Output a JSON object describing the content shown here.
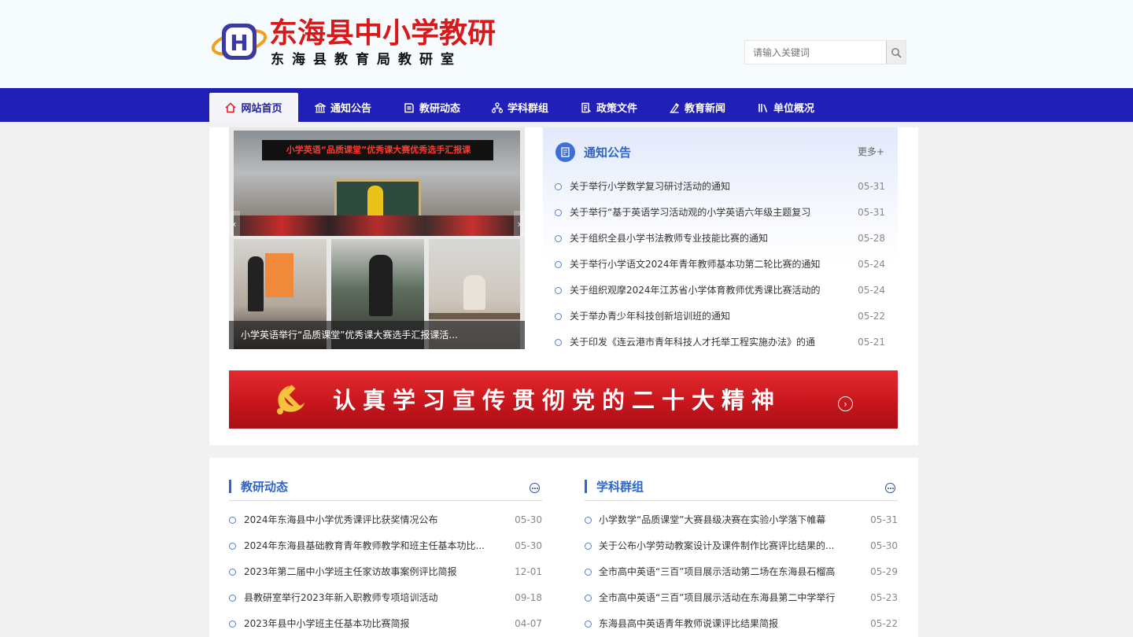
{
  "site": {
    "title": "东海县中小学教研",
    "subtitle": "东海县教育局教研室",
    "logo_letter": "H"
  },
  "search": {
    "placeholder": "请输入关键词",
    "button_icon": "search-icon"
  },
  "nav": {
    "items": [
      {
        "label": "网站首页",
        "icon": "home-icon",
        "active": true
      },
      {
        "label": "通知公告",
        "icon": "bank-icon",
        "active": false
      },
      {
        "label": "教研动态",
        "icon": "book-icon",
        "active": false
      },
      {
        "label": "学科群组",
        "icon": "network-icon",
        "active": false
      },
      {
        "label": "政策文件",
        "icon": "document-icon",
        "active": false
      },
      {
        "label": "教育新闻",
        "icon": "news-icon",
        "active": false
      },
      {
        "label": "单位概况",
        "icon": "library-icon",
        "active": false
      }
    ]
  },
  "slider": {
    "banner_text": "小学英语“品质课堂”优秀课大赛优秀选手汇报课",
    "caption": "小学英语举行“品质课堂”优秀课大赛选手汇报课活..."
  },
  "notice": {
    "title": "通知公告",
    "more": "更多+",
    "items": [
      {
        "text": "关于举行小学数学复习研讨活动的通知",
        "date": "05-31"
      },
      {
        "text": "关于举行“基于英语学习活动观的小学英语六年级主题复习",
        "date": "05-31"
      },
      {
        "text": "关于组织全县小学书法教师专业技能比赛的通知",
        "date": "05-28"
      },
      {
        "text": "关于举行小学语文2024年青年教师基本功第二轮比赛的通知",
        "date": "05-24"
      },
      {
        "text": "关于组织观摩2024年江苏省小学体育教师优秀课比赛活动的",
        "date": "05-24"
      },
      {
        "text": "关于举办青少年科技创新培训班的通知",
        "date": "05-22"
      },
      {
        "text": "关于印发《连云港市青年科技人才托举工程实施办法》的通",
        "date": "05-21"
      }
    ]
  },
  "banner": {
    "text": "认真学习宣传贯彻党的二十大精神",
    "arrow": "›"
  },
  "research": {
    "title": "教研动态",
    "items": [
      {
        "text": "2024年东海县中小学优秀课评比获奖情况公布",
        "date": "05-30"
      },
      {
        "text": "2024年东海县基础教育青年教师教学和班主任基本功比...",
        "date": "05-30"
      },
      {
        "text": "2023年第二届中小学班主任家访故事案例评比简报",
        "date": "12-01"
      },
      {
        "text": "县教研室举行2023年新入职教师专项培训活动",
        "date": "09-18"
      },
      {
        "text": "2023年县中小学班主任基本功比赛简报",
        "date": "04-07"
      }
    ]
  },
  "groups": {
    "title": "学科群组",
    "items": [
      {
        "text": "小学数学“品质课堂”大赛县级决赛在实验小学落下帷幕",
        "date": "05-31"
      },
      {
        "text": "关于公布小学劳动教案设计及课件制作比赛评比结果的...",
        "date": "05-30"
      },
      {
        "text": "全市高中英语“三百”项目展示活动第二场在东海县石榴高",
        "date": "05-29"
      },
      {
        "text": "全市高中英语“三百”项目展示活动在东海县第二中学举行",
        "date": "05-23"
      },
      {
        "text": "东海县高中英语青年教师说课评比结果简报",
        "date": "05-22"
      }
    ]
  },
  "colors": {
    "nav_bg": "#2020b8",
    "accent_blue": "#2e66c8",
    "brand_red": "#d7191c",
    "banner_red": "#c8161d"
  }
}
